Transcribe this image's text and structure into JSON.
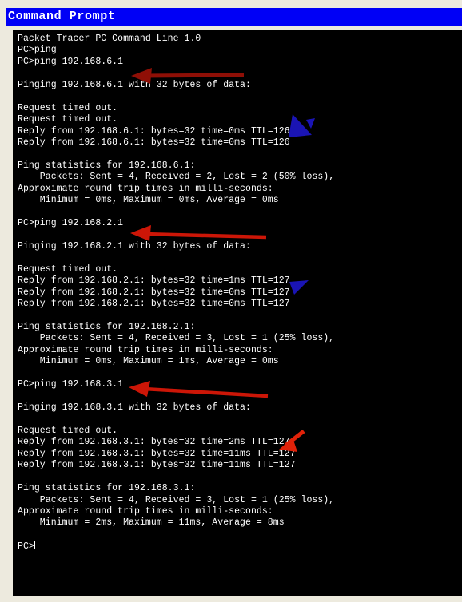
{
  "window": {
    "title": "Command Prompt",
    "title_bar_color": "#0000f6",
    "title_text_color": "#ffffff",
    "terminal_bg_color": "#000000",
    "terminal_text_color": "#ffffff",
    "page_bg_color": "#edeade"
  },
  "terminal": {
    "header": "Packet Tracer PC Command Line 1.0",
    "prompt": "PC>",
    "lines": [
      "Packet Tracer PC Command Line 1.0",
      "PC>ping",
      "PC>ping 192.168.6.1",
      "",
      "Pinging 192.168.6.1 with 32 bytes of data:",
      "",
      "Request timed out.",
      "Request timed out.",
      "Reply from 192.168.6.1: bytes=32 time=0ms TTL=126",
      "Reply from 192.168.6.1: bytes=32 time=0ms TTL=126",
      "",
      "Ping statistics for 192.168.6.1:",
      "    Packets: Sent = 4, Received = 2, Lost = 2 (50% loss),",
      "Approximate round trip times in milli-seconds:",
      "    Minimum = 0ms, Maximum = 0ms, Average = 0ms",
      "",
      "PC>ping 192.168.2.1",
      "",
      "Pinging 192.168.2.1 with 32 bytes of data:",
      "",
      "Request timed out.",
      "Reply from 192.168.2.1: bytes=32 time=1ms TTL=127",
      "Reply from 192.168.2.1: bytes=32 time=0ms TTL=127",
      "Reply from 192.168.2.1: bytes=32 time=0ms TTL=127",
      "",
      "Ping statistics for 192.168.2.1:",
      "    Packets: Sent = 4, Received = 3, Lost = 1 (25% loss),",
      "Approximate round trip times in milli-seconds:",
      "    Minimum = 0ms, Maximum = 1ms, Average = 0ms",
      "",
      "PC>ping 192.168.3.1",
      "",
      "Pinging 192.168.3.1 with 32 bytes of data:",
      "",
      "Request timed out.",
      "Reply from 192.168.3.1: bytes=32 time=2ms TTL=127",
      "Reply from 192.168.3.1: bytes=32 time=11ms TTL=127",
      "Reply from 192.168.3.1: bytes=32 time=11ms TTL=127",
      "",
      "Ping statistics for 192.168.3.1:",
      "    Packets: Sent = 4, Received = 3, Lost = 1 (25% loss),",
      "Approximate round trip times in milli-seconds:",
      "    Minimum = 2ms, Maximum = 11ms, Average = 8ms",
      "",
      "PC>"
    ],
    "ping_sessions": [
      {
        "command": "PC>ping 192.168.6.1",
        "target": "192.168.6.1",
        "bytes": 32,
        "replies": [
          {
            "status": "Request timed out."
          },
          {
            "status": "Request timed out."
          },
          {
            "status": "Reply",
            "bytes": 32,
            "time": "0ms",
            "ttl": 126
          },
          {
            "status": "Reply",
            "bytes": 32,
            "time": "0ms",
            "ttl": 126
          }
        ],
        "sent": 4,
        "received": 2,
        "lost": 2,
        "loss_percent": "50%",
        "minimum": "0ms",
        "maximum": "0ms",
        "average": "0ms"
      },
      {
        "command": "PC>ping 192.168.2.1",
        "target": "192.168.2.1",
        "bytes": 32,
        "replies": [
          {
            "status": "Request timed out."
          },
          {
            "status": "Reply",
            "bytes": 32,
            "time": "1ms",
            "ttl": 127
          },
          {
            "status": "Reply",
            "bytes": 32,
            "time": "0ms",
            "ttl": 127
          },
          {
            "status": "Reply",
            "bytes": 32,
            "time": "0ms",
            "ttl": 127
          }
        ],
        "sent": 4,
        "received": 3,
        "lost": 1,
        "loss_percent": "25%",
        "minimum": "0ms",
        "maximum": "1ms",
        "average": "0ms"
      },
      {
        "command": "PC>ping 192.168.3.1",
        "target": "192.168.3.1",
        "bytes": 32,
        "replies": [
          {
            "status": "Request timed out."
          },
          {
            "status": "Reply",
            "bytes": 32,
            "time": "2ms",
            "ttl": 127
          },
          {
            "status": "Reply",
            "bytes": 32,
            "time": "11ms",
            "ttl": 127
          },
          {
            "status": "Reply",
            "bytes": 32,
            "time": "11ms",
            "ttl": 127
          }
        ],
        "sent": 4,
        "received": 3,
        "lost": 1,
        "loss_percent": "25%",
        "minimum": "2ms",
        "maximum": "11ms",
        "average": "8ms"
      }
    ]
  },
  "annotations": {
    "red_color_dark": "#9c1008",
    "red_color_bright": "#d21a09",
    "blue_color": "#1a14b4",
    "markers": [
      {
        "name": "arrow-ping-6-1",
        "kind": "arrow-left",
        "color": "#8f0f06"
      },
      {
        "name": "arrow-ping-2-1",
        "kind": "arrow-left",
        "color": "#cc1607"
      },
      {
        "name": "arrow-ping-3-1",
        "kind": "arrow-left",
        "color": "#cc1607"
      },
      {
        "name": "blue-marker-ttl-126",
        "kind": "triangle",
        "color": "#1a14b4"
      },
      {
        "name": "blue-marker-ttl-127",
        "kind": "triangle",
        "color": "#1a14b4"
      },
      {
        "name": "arrow-ttl-127-reply",
        "kind": "arrow-diagonal",
        "color": "#e02209"
      }
    ]
  }
}
